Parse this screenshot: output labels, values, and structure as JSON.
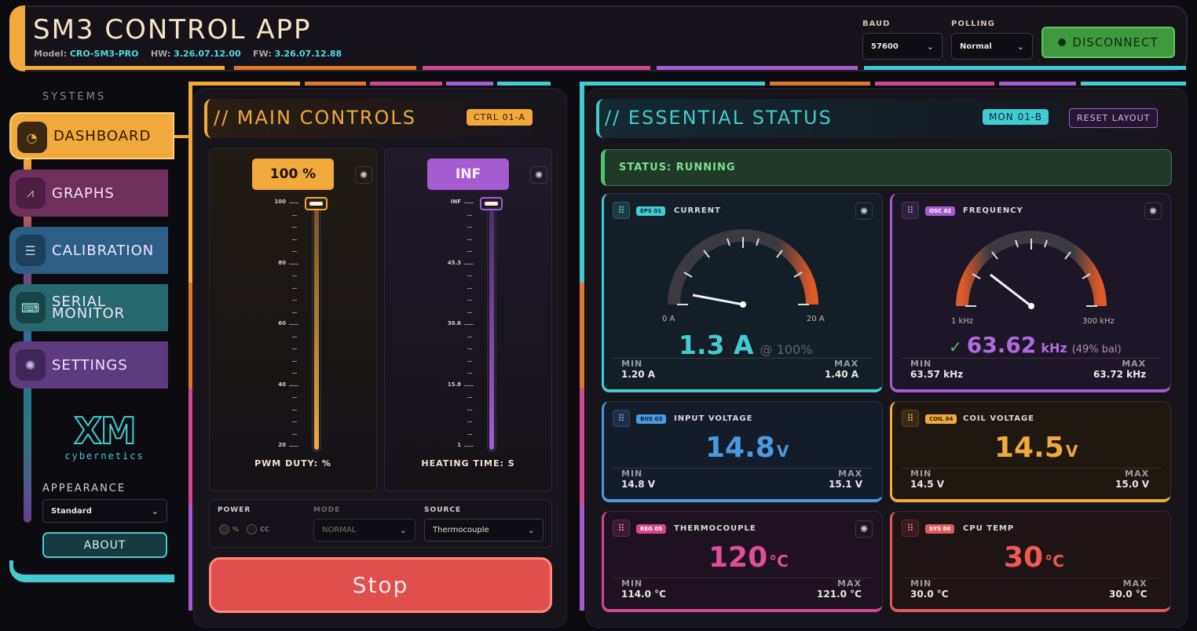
{
  "header": {
    "title": "SM3 CONTROL APP",
    "model_label": "Model:",
    "model": "CRO-SM3-PRO",
    "hw_label": "HW:",
    "hw": "3.26.07.12.00",
    "fw_label": "FW:",
    "fw": "3.26.07.12.88",
    "baud_label": "BAUD",
    "baud_value": "57600",
    "polling_label": "POLLING",
    "polling_value": "Normal",
    "disconnect_label": "DISCONNECT"
  },
  "sidebar": {
    "heading": "SYSTEMS",
    "items": [
      {
        "label": "DASHBOARD",
        "icon": "gauge-icon",
        "color": "#f2a93b"
      },
      {
        "label": "GRAPHS",
        "icon": "chart-icon",
        "color": "#8b3a6e"
      },
      {
        "label": "CALIBRATION",
        "icon": "sliders-icon",
        "color": "#2f6a94"
      },
      {
        "label": "SERIAL",
        "label2": "MONITOR",
        "icon": "terminal-icon",
        "color": "#2a7a82"
      },
      {
        "label": "SETTINGS",
        "icon": "gear-icon",
        "color": "#6a3f8e"
      }
    ],
    "logo_text": "cybernetics",
    "logo_mark": "XM",
    "appearance_label": "APPEARANCE",
    "appearance_value": "Standard",
    "about_label": "ABOUT"
  },
  "main_controls": {
    "title": "// MAIN CONTROLS",
    "tag": "CTRL 01-A",
    "pwm": {
      "value_label": "100 %",
      "ticks": [
        "100",
        "80",
        "60",
        "40",
        "20"
      ],
      "caption": "PWM DUTY: %",
      "level": 1.0
    },
    "heat": {
      "value_label": "INF",
      "ticks": [
        "INF",
        "45.3",
        "30.6",
        "15.8",
        "1"
      ],
      "caption": "HEATING TIME: S",
      "level": 1.0
    },
    "power_label": "POWER",
    "power_opt1": "%",
    "power_opt2": "CC",
    "mode_label": "MODE",
    "mode_value": "NORMAL",
    "source_label": "SOURCE",
    "source_value": "Thermocouple",
    "stop_label": "Stop"
  },
  "status": {
    "title": "// ESSENTIAL STATUS",
    "tag": "MON 01-B",
    "reset_label": "RESET LAYOUT",
    "state_text": "STATUS: RUNNING",
    "cards": {
      "current": {
        "badge": "EPS 01",
        "label": "CURRENT",
        "value": "1.3 A",
        "suffix": "@ 100%",
        "scale_min": "0 A",
        "scale_max": "20 A",
        "min_label": "MIN",
        "min": "1.20 A",
        "max_label": "MAX",
        "max": "1.40 A"
      },
      "frequency": {
        "badge": "OSC 02",
        "label": "FREQUENCY",
        "check": "✓",
        "value": "63.62",
        "unit": "kHz",
        "suffix": "(49% bal)",
        "scale_min": "1 kHz",
        "scale_max": "300 kHz",
        "min_label": "MIN",
        "min": "63.57 kHz",
        "max_label": "MAX",
        "max": "63.72 kHz"
      },
      "input_voltage": {
        "badge": "BUS 03",
        "label": "INPUT VOLTAGE",
        "value": "14.8",
        "unit": "V",
        "min_label": "MIN",
        "min": "14.8 V",
        "max_label": "MAX",
        "max": "15.1 V"
      },
      "coil_voltage": {
        "badge": "COIL 04",
        "label": "COIL VOLTAGE",
        "value": "14.5",
        "unit": "V",
        "min_label": "MIN",
        "min": "14.5 V",
        "max_label": "MAX",
        "max": "15.0 V"
      },
      "thermocouple": {
        "badge": "REG 05",
        "label": "THERMOCOUPLE",
        "value": "120",
        "unit": "°C",
        "min_label": "MIN",
        "min": "114.0 °C",
        "max_label": "MAX",
        "max": "121.0 °C"
      },
      "cpu_temp": {
        "badge": "SYS 06",
        "label": "CPU TEMP",
        "value": "30",
        "unit": "°C",
        "min_label": "MIN",
        "min": "30.0 °C",
        "max_label": "MAX",
        "max": "30.0 °C"
      }
    }
  }
}
